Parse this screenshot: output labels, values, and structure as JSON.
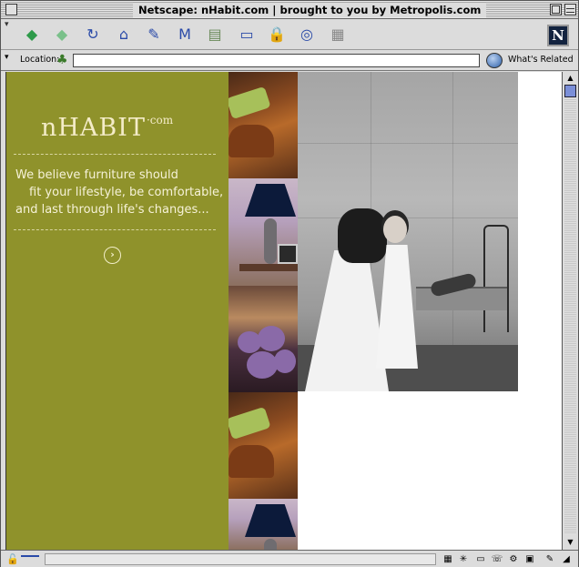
{
  "window": {
    "title": "Netscape: nHabit.com | brought to you by Metropolis.com"
  },
  "toolbar": {
    "buttons": [
      {
        "name": "back-button",
        "icon": "back-arrow-icon",
        "glyph": "◆",
        "color": "#2e9a4a"
      },
      {
        "name": "forward-button",
        "icon": "forward-arrow-icon",
        "glyph": "◆",
        "color": "#7ac08a"
      },
      {
        "name": "reload-button",
        "icon": "reload-icon",
        "glyph": "↻",
        "color": "#2a4aa8"
      },
      {
        "name": "home-button",
        "icon": "home-icon",
        "glyph": "⌂",
        "color": "#2a4aa8"
      },
      {
        "name": "search-button",
        "icon": "search-icon",
        "glyph": "✎",
        "color": "#2a4aa8"
      },
      {
        "name": "my-netscape-button",
        "icon": "my-netscape-icon",
        "glyph": "M",
        "color": "#2a4aa8"
      },
      {
        "name": "images-button",
        "icon": "images-icon",
        "glyph": "▤",
        "color": "#6a8a5a"
      },
      {
        "name": "print-button",
        "icon": "print-icon",
        "glyph": "▭",
        "color": "#2a4aa8"
      },
      {
        "name": "security-button",
        "icon": "lock-icon",
        "glyph": "🔒",
        "color": "#b82a2a"
      },
      {
        "name": "shop-button",
        "icon": "shop-icon",
        "glyph": "◎",
        "color": "#2a4aa8"
      },
      {
        "name": "stop-button",
        "icon": "stop-icon",
        "glyph": "▦",
        "color": "#888888"
      }
    ],
    "brand_logo": "N"
  },
  "location": {
    "label": "Location:",
    "url": "",
    "related_label": "What's Related"
  },
  "page": {
    "logo_main": "nHABIT",
    "logo_suffix": "·com",
    "tagline_line1": "We believe furniture should",
    "tagline_line2": "fit your lifestyle, be comfortable,",
    "tagline_line3": "and last through life's changes...",
    "enter_glyph": "›",
    "panel_color": "#8f922b"
  },
  "status": {
    "text": ""
  }
}
